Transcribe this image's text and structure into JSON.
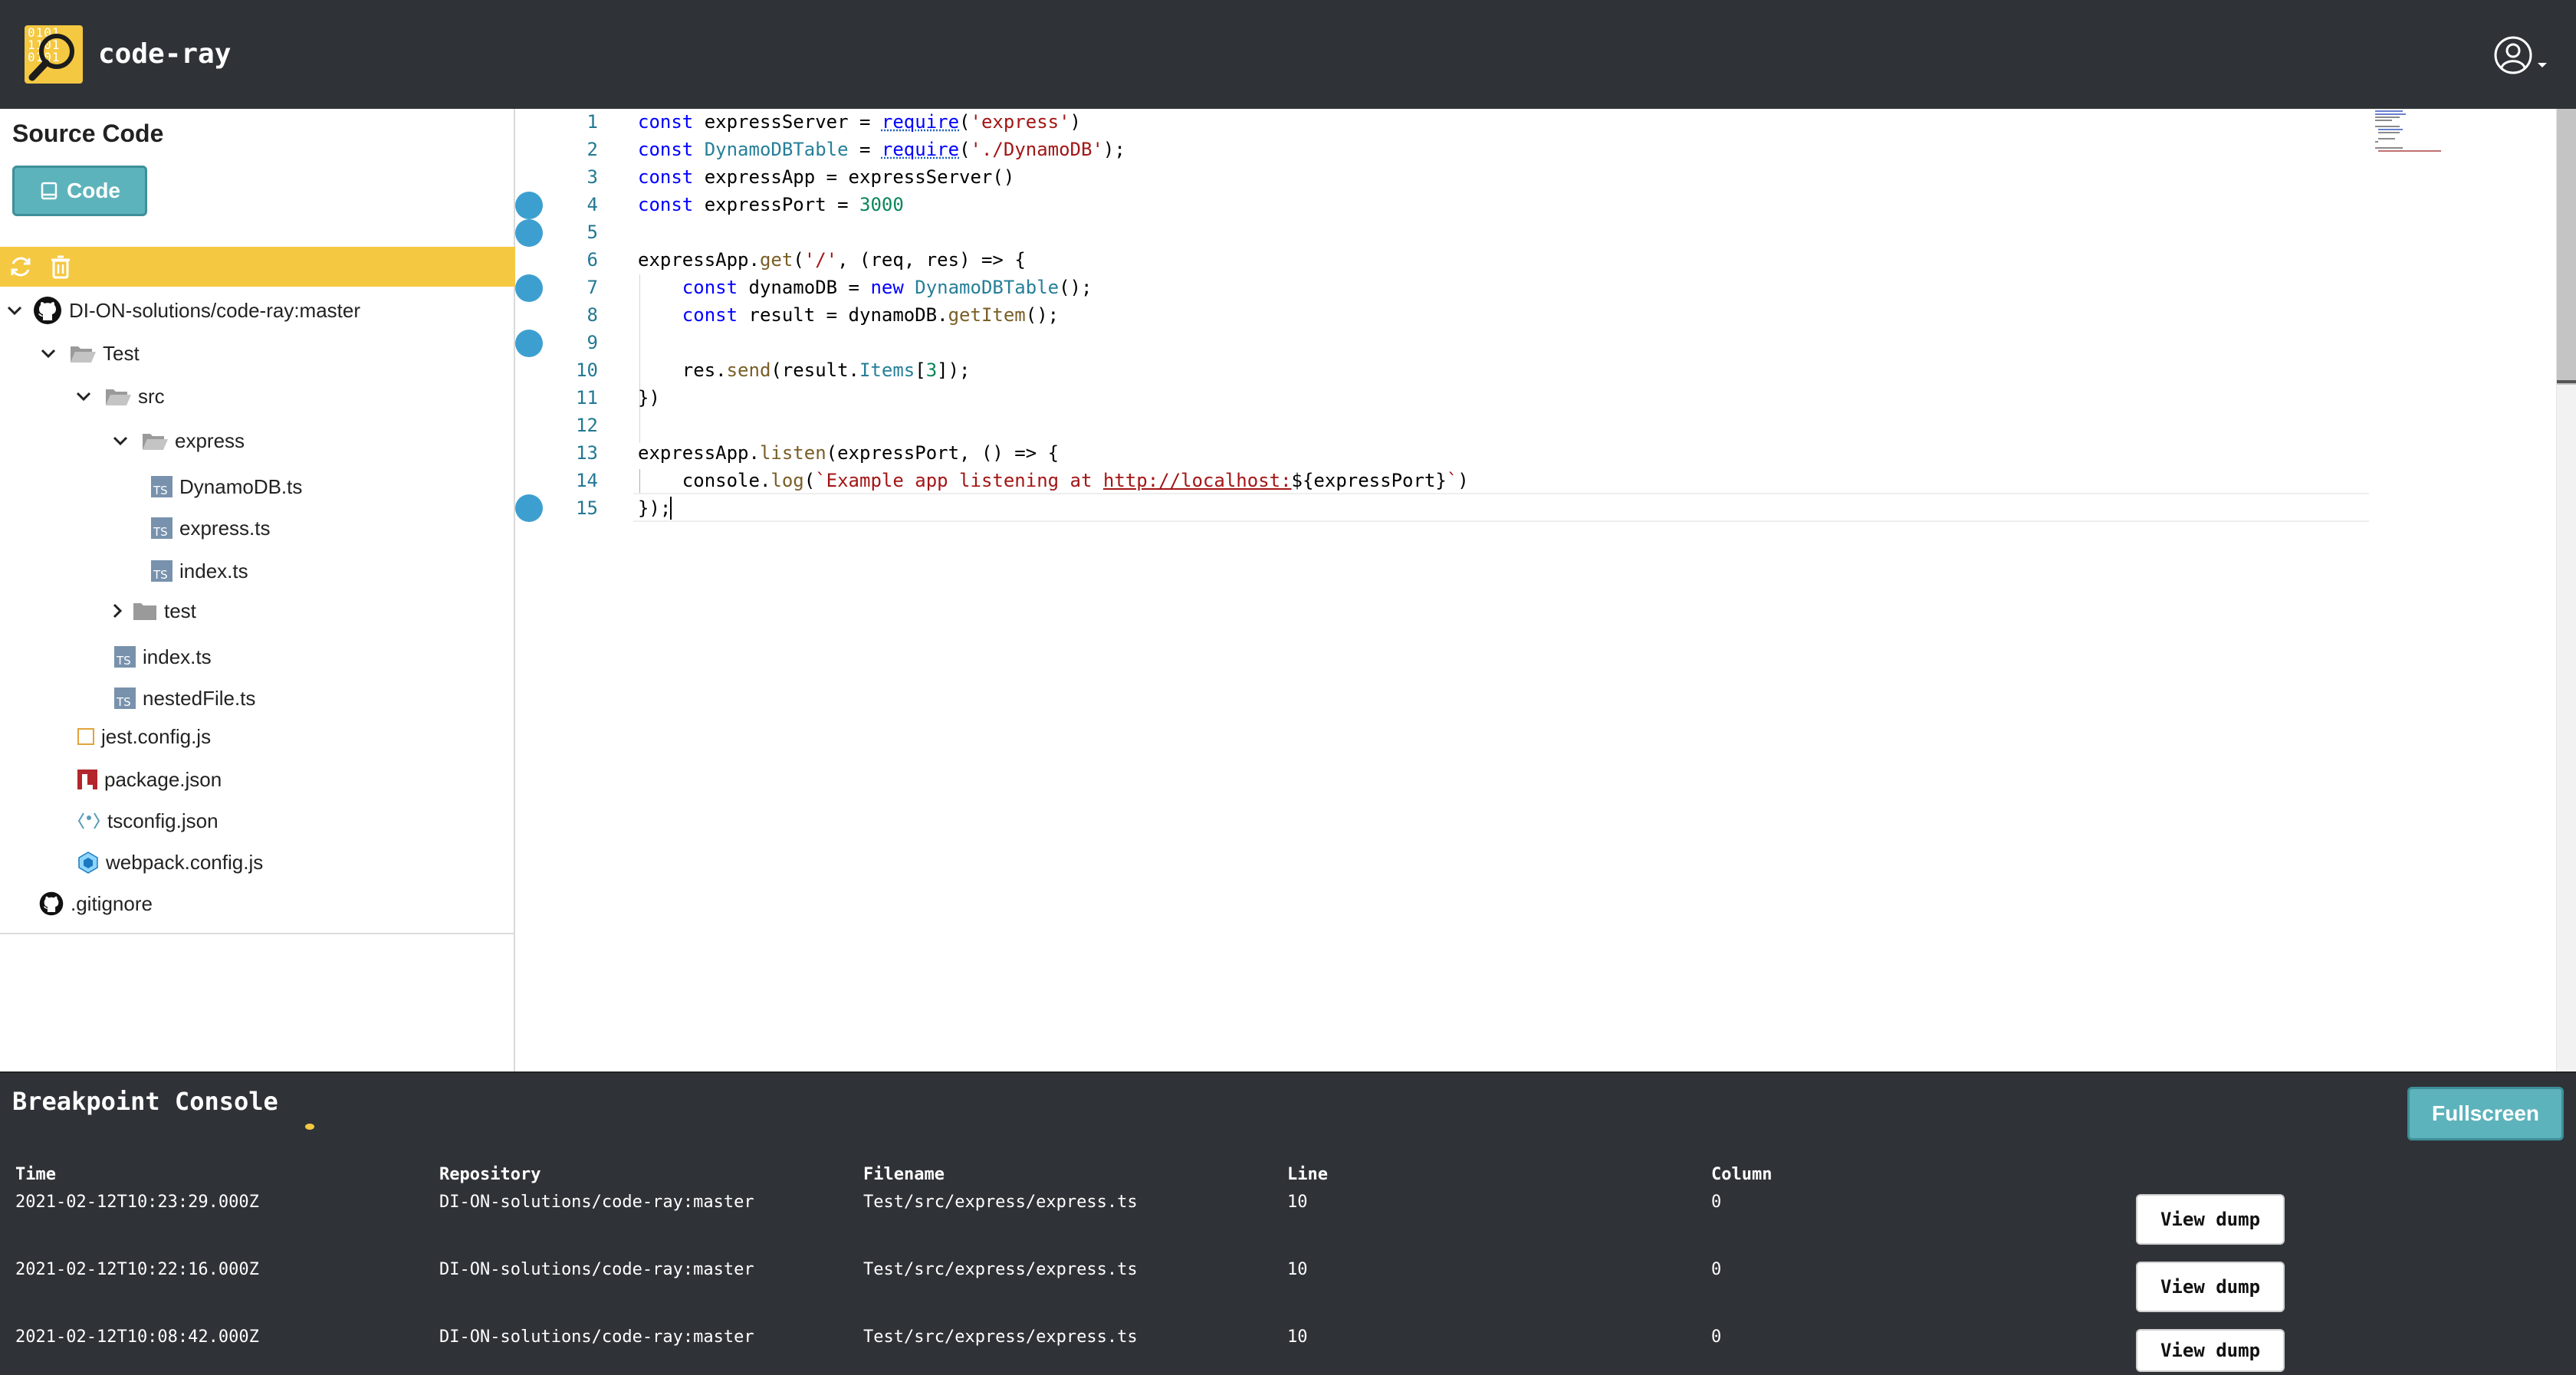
{
  "header": {
    "app_title": "code-ray",
    "logo_bits": [
      "0101",
      "1101",
      "0101"
    ]
  },
  "sidebar": {
    "title": "Source Code",
    "code_button_label": "Code",
    "tree": [
      {
        "label": "DI-ON-solutions/code-ray:master",
        "kind": "repo",
        "expanded": true
      },
      {
        "label": "Test",
        "kind": "folder",
        "expanded": true
      },
      {
        "label": "src",
        "kind": "folder",
        "expanded": true
      },
      {
        "label": "express",
        "kind": "folder",
        "expanded": true
      },
      {
        "label": "DynamoDB.ts",
        "kind": "ts"
      },
      {
        "label": "express.ts",
        "kind": "ts"
      },
      {
        "label": "index.ts",
        "kind": "ts"
      },
      {
        "label": "test",
        "kind": "folder",
        "expanded": false
      },
      {
        "label": "index.ts",
        "kind": "ts"
      },
      {
        "label": "nestedFile.ts",
        "kind": "ts"
      },
      {
        "label": "jest.config.js",
        "kind": "jest"
      },
      {
        "label": "package.json",
        "kind": "npm"
      },
      {
        "label": "tsconfig.json",
        "kind": "tsconfig"
      },
      {
        "label": "webpack.config.js",
        "kind": "webpack"
      },
      {
        "label": ".gitignore",
        "kind": "git"
      }
    ]
  },
  "editor": {
    "breakpoint_lines": [
      4,
      5,
      7,
      9,
      15
    ],
    "current_line": 15,
    "lines": [
      "const expressServer = require('express')",
      "const DynamoDBTable = require('./DynamoDB');",
      "const expressApp = expressServer()",
      "const expressPort = 3000",
      "",
      "expressApp.get('/', (req, res) => {",
      "    const dynamoDB = new DynamoDBTable();",
      "    const result = dynamoDB.getItem();",
      "",
      "    res.send(result.Items[3]);",
      "})",
      "",
      "expressApp.listen(expressPort, () => {",
      "    console.log(`Example app listening at http://localhost:${expressPort}`)",
      "});"
    ]
  },
  "console": {
    "title": "Breakpoint Console",
    "fullscreen_label": "Fullscreen",
    "columns": [
      "Time",
      "Repository",
      "Filename",
      "Line",
      "Column"
    ],
    "rows": [
      {
        "time": "2021-02-12T10:23:29.000Z",
        "repository": "DI-ON-solutions/code-ray:master",
        "filename": "Test/src/express/express.ts",
        "line": "10",
        "column": "0",
        "action": "View dump"
      },
      {
        "time": "2021-02-12T10:22:16.000Z",
        "repository": "DI-ON-solutions/code-ray:master",
        "filename": "Test/src/express/express.ts",
        "line": "10",
        "column": "0",
        "action": "View dump"
      },
      {
        "time": "2021-02-12T10:08:42.000Z",
        "repository": "DI-ON-solutions/code-ray:master",
        "filename": "Test/src/express/express.ts",
        "line": "10",
        "column": "0",
        "action": "View dump"
      }
    ]
  },
  "colors": {
    "accent_yellow": "#f5c842",
    "teal_button": "#5db3bb",
    "dark_bar": "#2f3337",
    "breakpoint": "#3d9fd0"
  }
}
